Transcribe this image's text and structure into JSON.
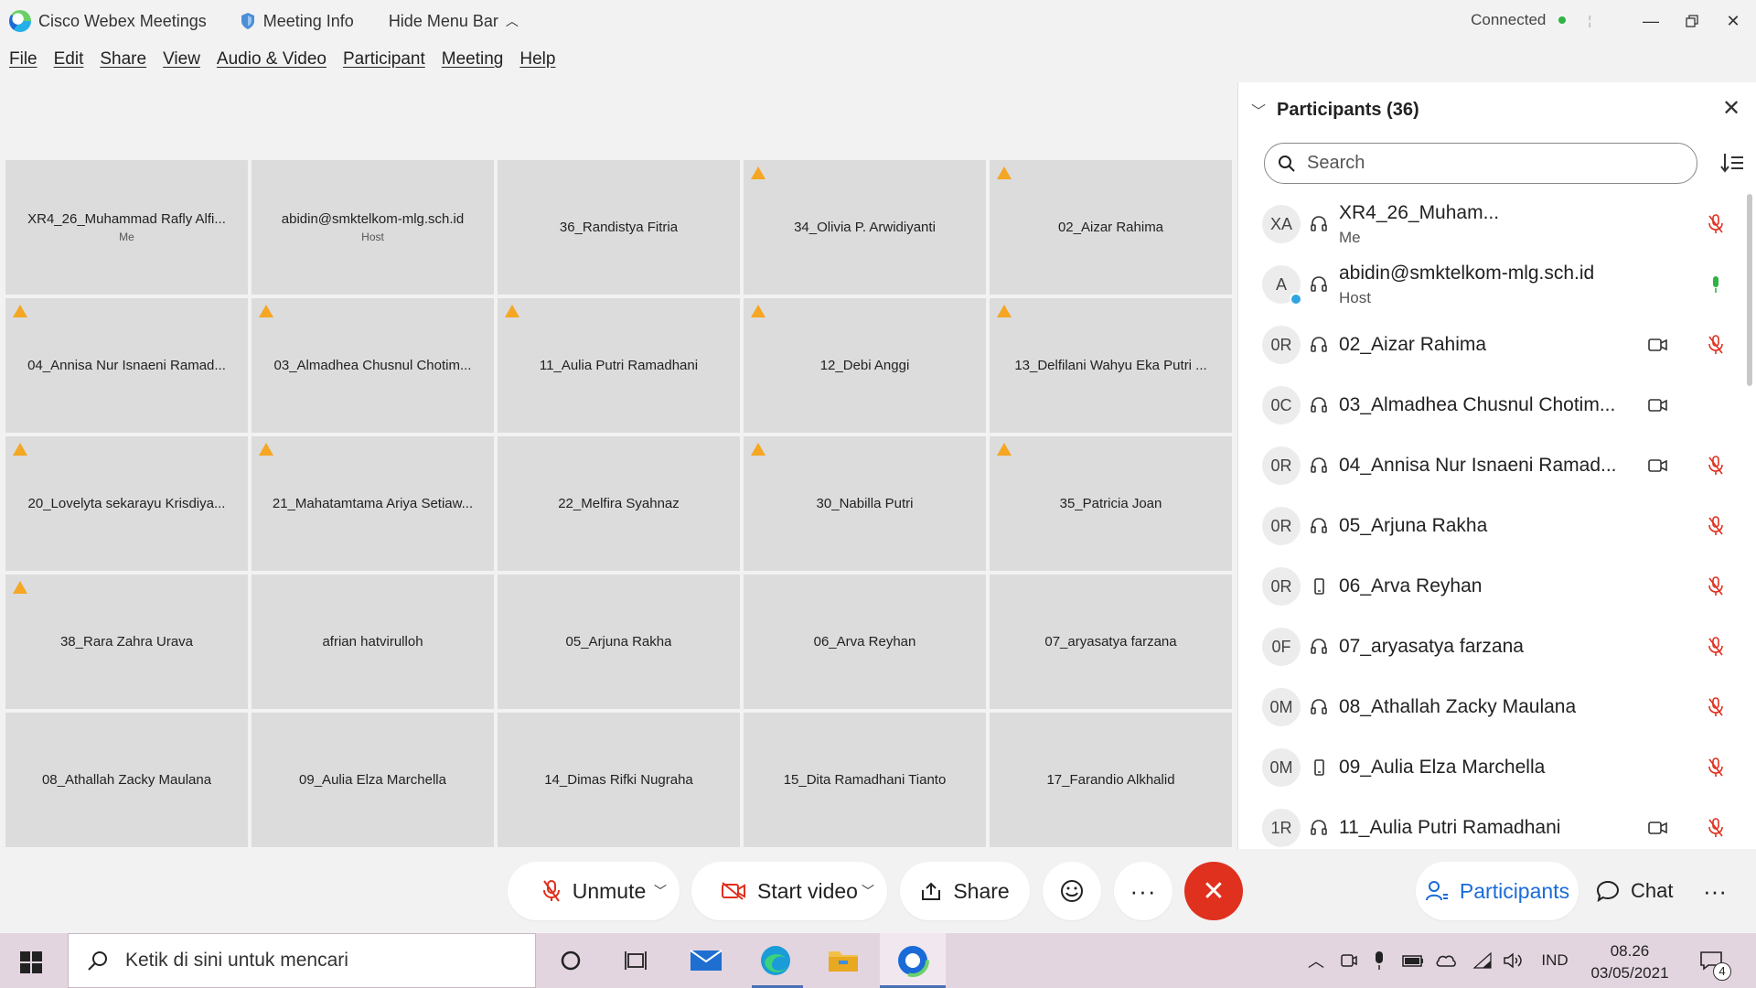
{
  "titlebar": {
    "app_name": "Cisco Webex Meetings",
    "meeting_info": "Meeting Info",
    "hide_menu": "Hide Menu Bar",
    "status": "Connected"
  },
  "menu": [
    "File",
    "Edit",
    "Share",
    "View",
    "Audio & Video",
    "Participant",
    "Meeting",
    "Help"
  ],
  "tiles": [
    {
      "name": "XR4_26_Muhammad Rafly Alfi...",
      "sub": "Me",
      "warn": false
    },
    {
      "name": "abidin@smktelkom-mlg.sch.id",
      "sub": "Host",
      "warn": false
    },
    {
      "name": "36_Randistya Fitria",
      "sub": "",
      "warn": false
    },
    {
      "name": "34_Olivia P. Arwidiyanti",
      "sub": "",
      "warn": true
    },
    {
      "name": "02_Aizar Rahima",
      "sub": "",
      "warn": true
    },
    {
      "name": "04_Annisa Nur Isnaeni Ramad...",
      "sub": "",
      "warn": true
    },
    {
      "name": "03_Almadhea Chusnul Chotim...",
      "sub": "",
      "warn": true
    },
    {
      "name": "11_Aulia Putri Ramadhani",
      "sub": "",
      "warn": true
    },
    {
      "name": "12_Debi Anggi",
      "sub": "",
      "warn": true
    },
    {
      "name": "13_Delfilani Wahyu Eka Putri ...",
      "sub": "",
      "warn": true
    },
    {
      "name": "20_Lovelyta sekarayu Krisdiya...",
      "sub": "",
      "warn": true
    },
    {
      "name": "21_Mahatamtama Ariya Setiaw...",
      "sub": "",
      "warn": true
    },
    {
      "name": "22_Melfira Syahnaz",
      "sub": "",
      "warn": false
    },
    {
      "name": "30_Nabilla Putri",
      "sub": "",
      "warn": true
    },
    {
      "name": "35_Patricia Joan",
      "sub": "",
      "warn": true
    },
    {
      "name": "38_Rara Zahra Urava",
      "sub": "",
      "warn": true
    },
    {
      "name": "afrian hatvirulloh",
      "sub": "",
      "warn": false
    },
    {
      "name": "05_Arjuna Rakha",
      "sub": "",
      "warn": false
    },
    {
      "name": "06_Arva Reyhan",
      "sub": "",
      "warn": false
    },
    {
      "name": "07_aryasatya farzana",
      "sub": "",
      "warn": false
    },
    {
      "name": "08_Athallah Zacky Maulana",
      "sub": "",
      "warn": false
    },
    {
      "name": "09_Aulia Elza Marchella",
      "sub": "",
      "warn": false
    },
    {
      "name": "14_Dimas Rifki Nugraha",
      "sub": "",
      "warn": false
    },
    {
      "name": "15_Dita Ramadhani Tianto",
      "sub": "",
      "warn": false
    },
    {
      "name": "17_Farandio Alkhalid",
      "sub": "",
      "warn": false
    }
  ],
  "participants_panel": {
    "title": "Participants (36)",
    "search_placeholder": "Search",
    "list": [
      {
        "initials": "XA",
        "name": "XR4_26_Muham...",
        "sub": "Me",
        "conn": "headset",
        "video": false,
        "mic": "muted"
      },
      {
        "initials": "A",
        "name": "abidin@smktelkom-mlg.sch.id",
        "sub": "Host",
        "conn": "headset",
        "video": false,
        "mic": "active",
        "host": true
      },
      {
        "initials": "0R",
        "name": "02_Aizar Rahima",
        "sub": "",
        "conn": "headset",
        "video": true,
        "mic": "muted"
      },
      {
        "initials": "0C",
        "name": "03_Almadhea Chusnul Chotim...",
        "sub": "",
        "conn": "headset",
        "video": true,
        "mic": "none"
      },
      {
        "initials": "0R",
        "name": "04_Annisa Nur Isnaeni Ramad...",
        "sub": "",
        "conn": "headset",
        "video": true,
        "mic": "muted"
      },
      {
        "initials": "0R",
        "name": "05_Arjuna Rakha",
        "sub": "",
        "conn": "headset",
        "video": false,
        "mic": "muted"
      },
      {
        "initials": "0R",
        "name": "06_Arva Reyhan",
        "sub": "",
        "conn": "phone",
        "video": false,
        "mic": "muted"
      },
      {
        "initials": "0F",
        "name": "07_aryasatya farzana",
        "sub": "",
        "conn": "headset",
        "video": false,
        "mic": "muted"
      },
      {
        "initials": "0M",
        "name": "08_Athallah Zacky Maulana",
        "sub": "",
        "conn": "headset",
        "video": false,
        "mic": "muted"
      },
      {
        "initials": "0M",
        "name": "09_Aulia Elza Marchella",
        "sub": "",
        "conn": "phone",
        "video": false,
        "mic": "muted"
      },
      {
        "initials": "1R",
        "name": "11_Aulia Putri Ramadhani",
        "sub": "",
        "conn": "headset",
        "video": true,
        "mic": "muted"
      }
    ]
  },
  "controls": {
    "unmute": "Unmute",
    "start_video": "Start video",
    "share": "Share",
    "participants": "Participants",
    "chat": "Chat"
  },
  "taskbar": {
    "search_placeholder": "Ketik di sini untuk mencari",
    "lang": "IND",
    "time": "08.26",
    "date": "03/05/2021",
    "notifications": "4"
  },
  "colors": {
    "accent_blue": "#1a6bd8",
    "mute_red": "#e0301e",
    "warning": "#f5a623",
    "mic_green": "#2fb344"
  }
}
